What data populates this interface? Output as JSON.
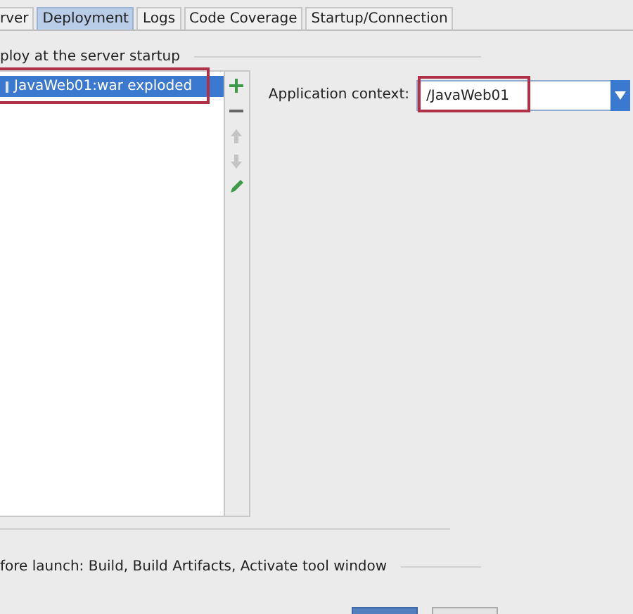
{
  "tabs": [
    {
      "label": "rver",
      "selected": false
    },
    {
      "label": "Deployment",
      "selected": true
    },
    {
      "label": "Logs",
      "selected": false
    },
    {
      "label": "Code Coverage",
      "selected": false
    },
    {
      "label": "Startup/Connection",
      "selected": false
    }
  ],
  "deploy_group": {
    "title": "ploy at the server startup",
    "items": [
      {
        "label": "JavaWeb01:war exploded",
        "selected": true
      }
    ],
    "highlighted": true,
    "toolbar": [
      {
        "kind": "add",
        "disabled": false
      },
      {
        "kind": "remove",
        "disabled": false
      },
      {
        "kind": "up",
        "disabled": true
      },
      {
        "kind": "down",
        "disabled": true
      },
      {
        "kind": "edit",
        "disabled": false
      }
    ]
  },
  "application_context": {
    "label": "Application context:",
    "value": "/JavaWeb01",
    "highlighted": true
  },
  "before_launch": {
    "label": "fore launch: Build, Build Artifacts, Activate tool window"
  }
}
